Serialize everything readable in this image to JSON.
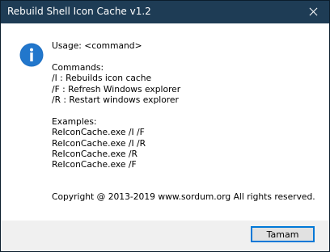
{
  "window": {
    "title": "Rebuild Shell Icon Cache v1.2",
    "close_icon": "close-icon"
  },
  "message": {
    "icon": "info-icon",
    "usage": "Usage: <command>",
    "commands_header": "Commands:",
    "commands": [
      "/I : Rebuilds icon cache",
      "/F : Refresh Windows explorer",
      "/R : Restart windows explorer"
    ],
    "examples_header": "Examples:",
    "examples": [
      "ReIconCache.exe /I /F",
      "ReIconCache.exe /I /R",
      "ReIconCache.exe /R",
      "ReIconCache.exe /F"
    ],
    "copyright": "Copyright @ 2013-2019 www.sordum.org All rights reserved."
  },
  "buttons": {
    "ok_label": "Tamam"
  },
  "colors": {
    "titlebar": "#1e3c55",
    "content_bg": "#ffffff",
    "footer_bg": "#f0f0f0",
    "info_icon": "#1b6ec2",
    "button_border": "#0078d7"
  }
}
